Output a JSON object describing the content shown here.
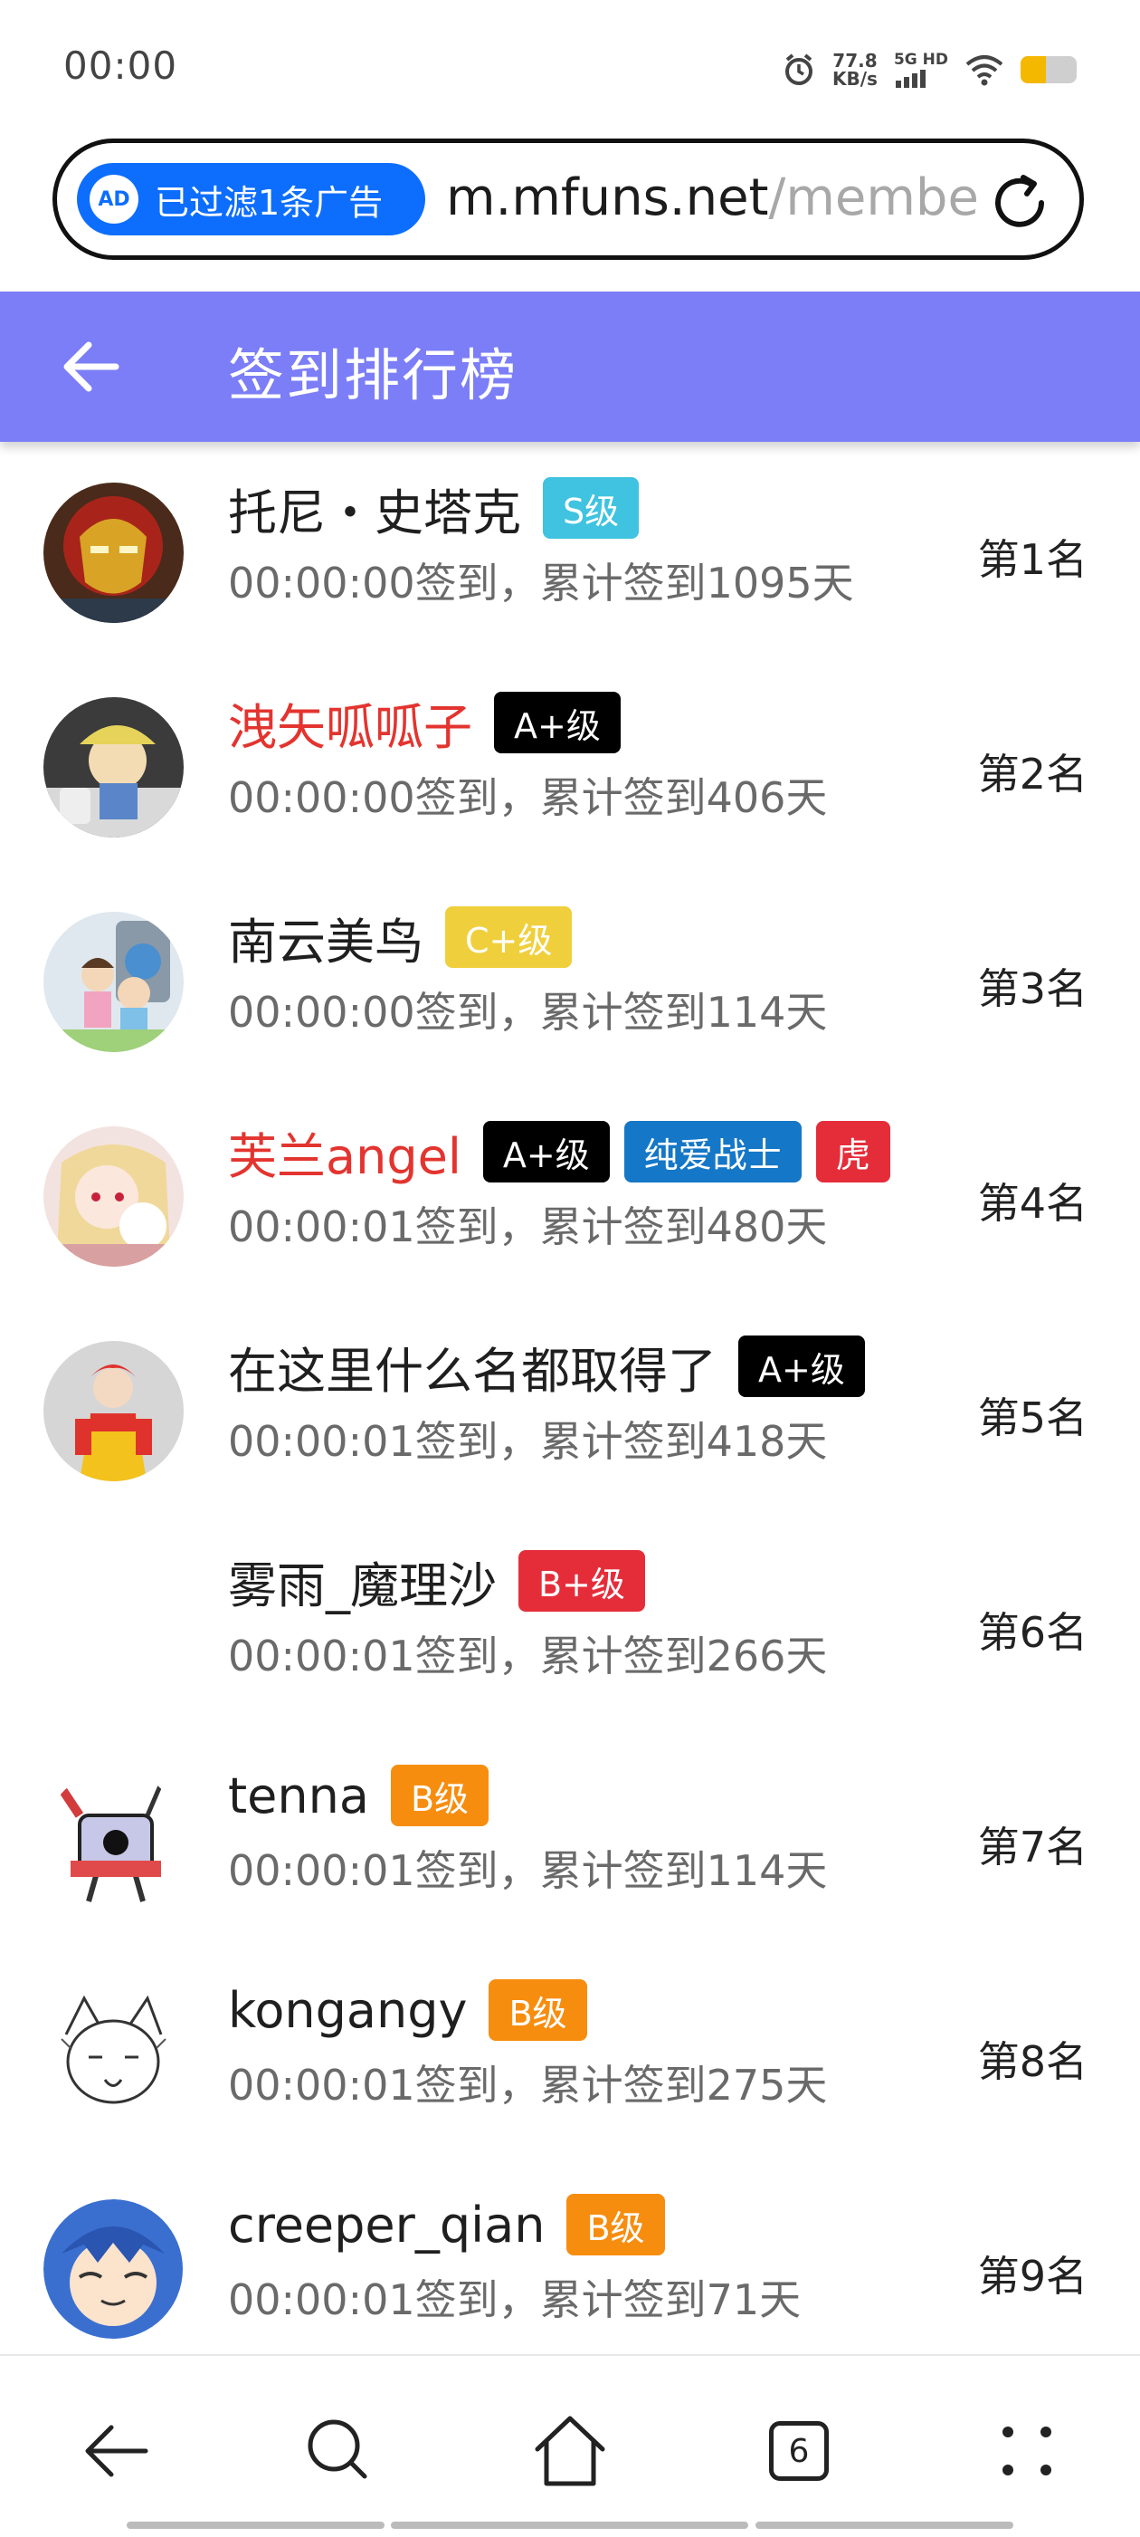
{
  "status": {
    "time": "00:00",
    "speed_value": "77.8",
    "speed_unit": "KB/s",
    "network": "5G HD",
    "battery_level": 0.45,
    "battery_color": "#f5b800"
  },
  "urlbar": {
    "ad_filter_label": "已过滤1条广告",
    "ad_icon_text": "AD",
    "host": "m.mfuns.net",
    "path": "/membe"
  },
  "header": {
    "title": "签到排行榜",
    "background": "#7b7ef6"
  },
  "rows": [
    {
      "name": "托尼・史塔克",
      "name_color": "normal",
      "badges": [
        {
          "text": "S级",
          "color": "#3fc3e0"
        }
      ],
      "detail": "00:00:00签到，累计签到1095天",
      "rank": "第1名",
      "avatar": "iron-man-avatar"
    },
    {
      "name": "洩矢呱呱子",
      "name_color": "red",
      "badges": [
        {
          "text": "A+级",
          "color": "#000000"
        }
      ],
      "detail": "00:00:00签到，累计签到406天",
      "rank": "第2名",
      "avatar": "figure-avatar"
    },
    {
      "name": "南云美鸟",
      "name_color": "normal",
      "badges": [
        {
          "text": "C+级",
          "color": "#f0cf3c"
        }
      ],
      "detail": "00:00:00签到，累计签到114天",
      "rank": "第3名",
      "avatar": "anime-kids-avatar"
    },
    {
      "name": "芙兰angel",
      "name_color": "red",
      "badges": [
        {
          "text": "A+级",
          "color": "#000000"
        },
        {
          "text": "纯爱战士",
          "color": "#1577c7"
        },
        {
          "text": "虎",
          "color": "#e52d3a"
        }
      ],
      "detail": "00:00:01签到，累计签到480天",
      "rank": "第4名",
      "avatar": "anime-girl-avatar"
    },
    {
      "name": "在这里什么名都取得了",
      "name_color": "normal",
      "badges": [
        {
          "text": "A+级",
          "color": "#000000"
        }
      ],
      "detail": "00:00:01签到，累计签到418天",
      "rank": "第5名",
      "avatar": "clown-avatar"
    },
    {
      "name": "雾雨_魔理沙",
      "name_color": "normal",
      "badges": [
        {
          "text": "B+级",
          "color": "#e52d3a"
        }
      ],
      "detail": "00:00:01签到，累计签到266天",
      "rank": "第6名",
      "avatar": "blank-avatar"
    },
    {
      "name": "tenna",
      "name_color": "normal",
      "badges": [
        {
          "text": "B级",
          "color": "#f78d0f"
        }
      ],
      "detail": "00:00:01签到，累计签到114天",
      "rank": "第7名",
      "avatar": "tv-character-avatar"
    },
    {
      "name": "kongangy",
      "name_color": "normal",
      "badges": [
        {
          "text": "B级",
          "color": "#f78d0f"
        }
      ],
      "detail": "00:00:01签到，累计签到275天",
      "rank": "第8名",
      "avatar": "sketch-avatar"
    },
    {
      "name": "creeper_qian",
      "name_color": "normal",
      "badges": [
        {
          "text": "B级",
          "color": "#f78d0f"
        }
      ],
      "detail": "00:00:01签到，累计签到71天",
      "rank": "第9名",
      "avatar": "blue-hair-avatar"
    }
  ],
  "bottom_nav": {
    "tab_count": "6",
    "items": [
      "back-icon",
      "search-icon",
      "home-icon",
      "tabs-icon",
      "menu-icon"
    ]
  }
}
